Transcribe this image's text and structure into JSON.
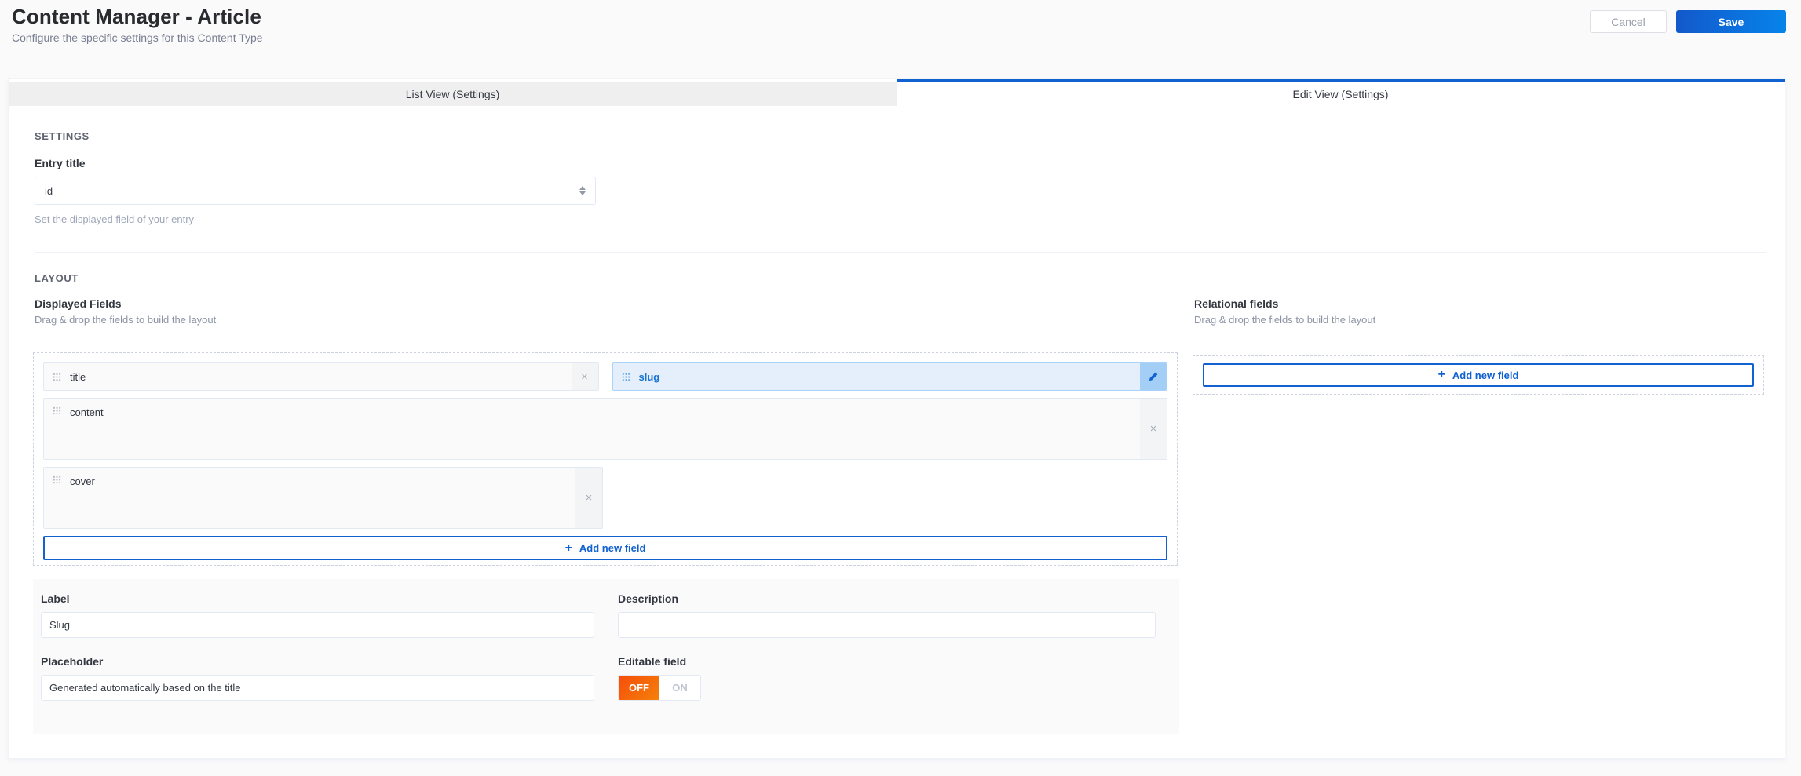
{
  "header": {
    "title": "Content Manager - Article",
    "subtitle": "Configure the specific settings for this Content Type",
    "cancel_label": "Cancel",
    "save_label": "Save"
  },
  "tabs": {
    "list_view_label": "List View (Settings)",
    "edit_view_label": "Edit View (Settings)",
    "active_tab": "Edit View (Settings)"
  },
  "settings_section": {
    "title": "SETTINGS",
    "entry_title": {
      "label": "Entry title",
      "value": "id",
      "help": "Set the displayed field of your entry"
    }
  },
  "layout_section": {
    "title": "LAYOUT",
    "displayed_fields": {
      "title": "Displayed Fields",
      "subtitle": "Drag & drop the fields to build the layout",
      "fields": [
        {
          "name": "title",
          "selected": false,
          "width": "half",
          "height": "short"
        },
        {
          "name": "slug",
          "selected": true,
          "width": "half",
          "height": "short"
        },
        {
          "name": "content",
          "selected": false,
          "width": "full",
          "height": "tall"
        },
        {
          "name": "cover",
          "selected": false,
          "width": "half",
          "height": "tall"
        }
      ],
      "add_button_label": "Add new field"
    },
    "relational_fields": {
      "title": "Relational fields",
      "subtitle": "Drag & drop the fields to build the layout",
      "add_button_label": "Add new field"
    }
  },
  "field_form": {
    "label": {
      "label": "Label",
      "value": "Slug"
    },
    "description": {
      "label": "Description",
      "value": ""
    },
    "placeholder": {
      "label": "Placeholder",
      "value": "Generated automatically based on the title"
    },
    "editable": {
      "label": "Editable field",
      "off_label": "OFF",
      "on_label": "ON",
      "value": "OFF"
    }
  },
  "icons": {
    "close": "×",
    "plus": "+"
  },
  "colors": {
    "accent_blue": "#1161d1",
    "save_gradient_start": "#1358cb",
    "save_gradient_end": "#0684ea",
    "selected_chip_bg": "#e4effb",
    "selected_chip_border": "#abd2f8",
    "selected_chip_text": "#1874d2",
    "edit_handle_bg": "#a3cef5",
    "toggle_off_gradient_start": "#f64d0a",
    "toggle_off_gradient_end": "#f5810a",
    "inactive_tab_bg": "#efefef"
  }
}
